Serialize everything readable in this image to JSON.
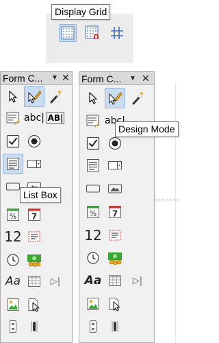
{
  "top_toolbar": {
    "tooltip": "Display Grid",
    "buttons": [
      {
        "name": "display-grid",
        "active": true
      },
      {
        "name": "snap-to-grid",
        "active": false
      },
      {
        "name": "helplines-while-moving",
        "active": false
      }
    ]
  },
  "panels": [
    {
      "title": "Form C...",
      "menu_glyph": "▼",
      "close_glyph": "✕",
      "tooltip": "List Box"
    },
    {
      "title": "Form C...",
      "menu_glyph": "▼",
      "close_glyph": "✕",
      "tooltip": "Design Mode"
    }
  ],
  "tools": {
    "text_box_label": "abc|",
    "label_field_label": "AB|",
    "numeric_field_label": "12",
    "formatted_field_label": "Aa",
    "date_field_label": "7",
    "pattern_label": "%",
    "nav_bar_glyph": "▷|"
  },
  "colors": {
    "active_bg": "#c9dcf2",
    "active_border": "#90b2d9",
    "accent_orange": "#e8a81f",
    "accent_red": "#e0302a",
    "accent_green": "#3aa635",
    "grid_blue": "#3f6fb8"
  }
}
